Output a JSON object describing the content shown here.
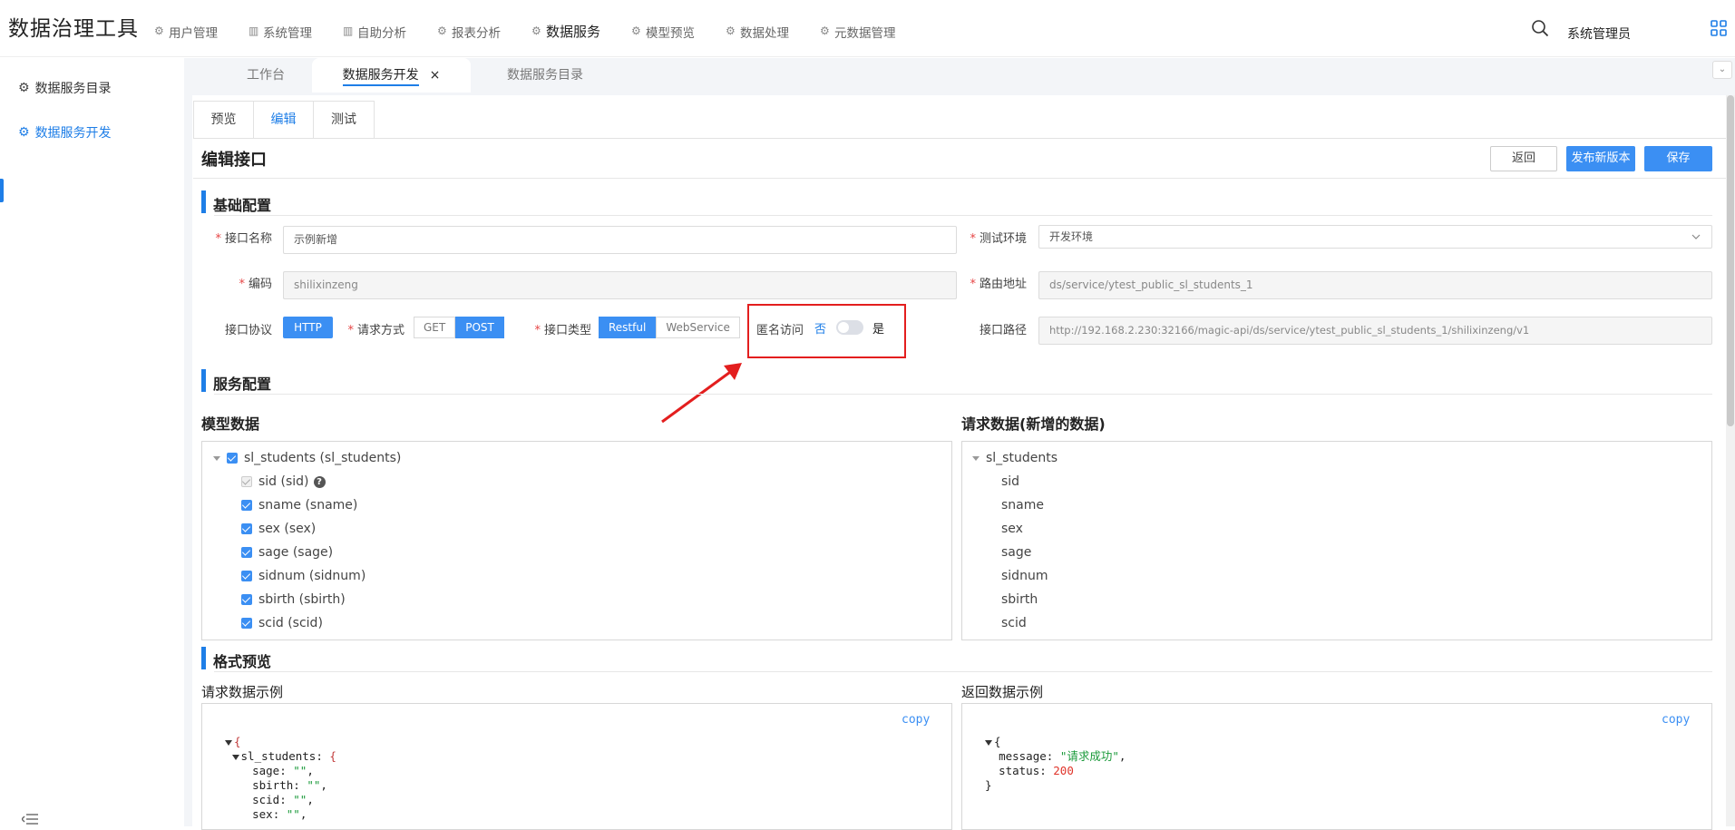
{
  "app": {
    "title": "数据治理工具",
    "user": "系统管理员"
  },
  "nav": [
    {
      "label": "用户管理",
      "icon": "gear-icon"
    },
    {
      "label": "系统管理",
      "icon": "bar-chart-icon"
    },
    {
      "label": "自助分析",
      "icon": "bar-chart-icon"
    },
    {
      "label": "报表分析",
      "icon": "gear-icon"
    },
    {
      "label": "数据服务",
      "icon": "gear-icon",
      "active": true
    },
    {
      "label": "模型预览",
      "icon": "gear-icon"
    },
    {
      "label": "数据处理",
      "icon": "gear-icon"
    },
    {
      "label": "元数据管理",
      "icon": "gear-icon"
    }
  ],
  "sidebar": {
    "items": [
      {
        "label": "数据服务目录"
      },
      {
        "label": "数据服务开发",
        "active": true
      }
    ]
  },
  "tabs": [
    {
      "label": "工作台"
    },
    {
      "label": "数据服务开发",
      "active": true,
      "close": "×"
    },
    {
      "label": "数据服务目录"
    }
  ],
  "subtabs": [
    "预览",
    "编辑",
    "测试"
  ],
  "page": {
    "title": "编辑接口",
    "buttons": {
      "back": "返回",
      "publish": "发布新版本",
      "save": "保存"
    }
  },
  "basic": {
    "section": "基础配置",
    "name_label": "接口名称",
    "name_value": "示例新增",
    "env_label": "测试环境",
    "env_value": "开发环境",
    "code_label": "编码",
    "code_value": "shilixinzeng",
    "route_label": "路由地址",
    "route_value": "ds/service/ytest_public_sl_students_1",
    "protocol_label": "接口协议",
    "protocol_value": "HTTP",
    "method_label": "请求方式",
    "method_options": [
      "GET",
      "POST"
    ],
    "method_selected": "POST",
    "type_label": "接口类型",
    "type_options": [
      "Restful",
      "WebService"
    ],
    "type_selected": "Restful",
    "anon_label": "匿名访问",
    "anon_no": "否",
    "anon_yes": "是",
    "path_label": "接口路径",
    "path_value": "http://192.168.2.230:32166/magic-api/ds/service/ytest_public_sl_students_1/shilixinzeng/v1"
  },
  "service": {
    "section": "服务配置",
    "model_title": "模型数据",
    "request_title": "请求数据(新增的数据)",
    "model_root": "sl_students (sl_students)",
    "model_fields": [
      "sid (sid)",
      "sname (sname)",
      "sex (sex)",
      "sage (sage)",
      "sidnum (sidnum)",
      "sbirth (sbirth)",
      "scid (scid)"
    ],
    "request_root": "sl_students",
    "request_fields": [
      "sid",
      "sname",
      "sex",
      "sage",
      "sidnum",
      "sbirth",
      "scid"
    ]
  },
  "preview": {
    "section": "格式预览",
    "req_title": "请求数据示例",
    "resp_title": "返回数据示例",
    "copy": "copy",
    "req_root_key": "sl_students",
    "req_keys": [
      "sage",
      "sbirth",
      "scid",
      "sex"
    ],
    "resp_message_key": "message",
    "resp_message_value": "\"请求成功\"",
    "resp_status_key": "status",
    "resp_status_value": "200"
  }
}
